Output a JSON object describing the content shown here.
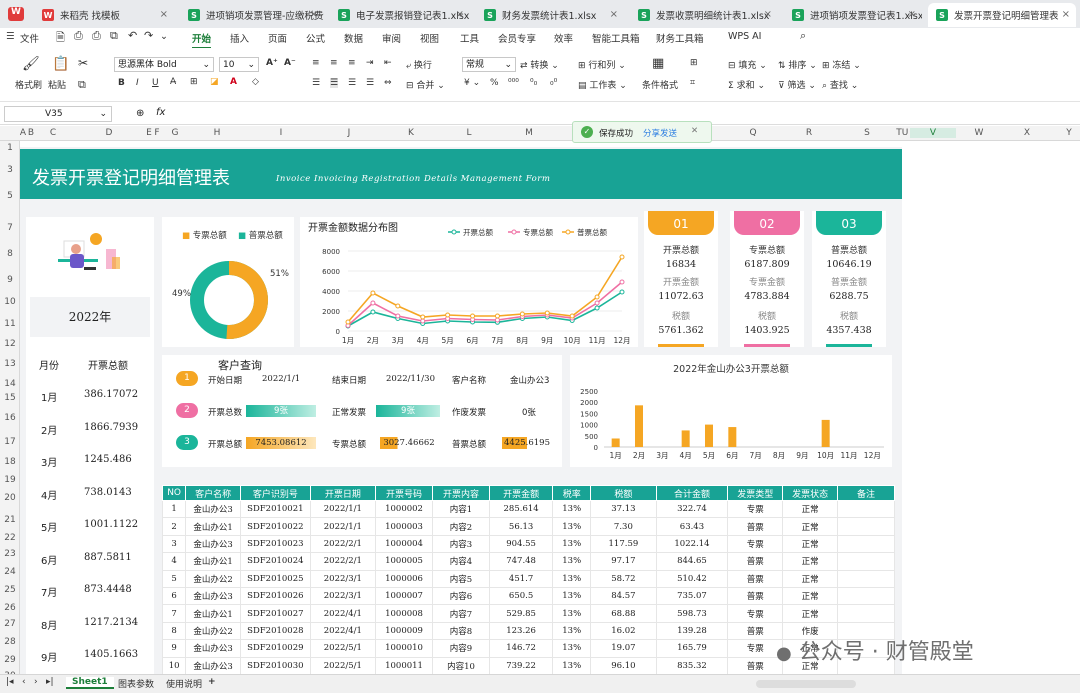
{
  "tabs": [
    {
      "label": "来稻壳 找模板",
      "color": "#e03b3b"
    },
    {
      "label": "进项销项发票管理-应缴税费计算",
      "color": "#1aa35a"
    },
    {
      "label": "电子发票报销登记表1.xlsx",
      "color": "#1aa35a"
    },
    {
      "label": "财务发票统计表1.xlsx",
      "color": "#1aa35a"
    },
    {
      "label": "发票收票明细统计表1.xlsx",
      "color": "#1aa35a"
    },
    {
      "label": "进项销项发票登记表1.xlsx",
      "color": "#1aa35a"
    },
    {
      "label": "发票开票登记明细管理表",
      "color": "#1aa35a"
    }
  ],
  "menu": {
    "file": "文件",
    "items": [
      "开始",
      "插入",
      "页面",
      "公式",
      "数据",
      "审阅",
      "视图",
      "工具",
      "会员专享",
      "效率",
      "智能工具箱",
      "财务工具箱",
      "WPS AI"
    ]
  },
  "ribbon": {
    "format_painter": "格式刷",
    "paste": "粘贴",
    "font": "思源黑体 Bold",
    "size": "10",
    "wrap": "换行",
    "merge": "合并",
    "numfmt": "常规",
    "convert": "转换",
    "rowcol": "行和列",
    "worksheet": "工作表",
    "condfmt": "条件格式",
    "fill": "填充",
    "sort": "排序",
    "freeze": "冻结",
    "sum": "求和",
    "filter": "筛选",
    "find": "查找"
  },
  "formula": {
    "cellref": "V35",
    "fx": "fx"
  },
  "toast": {
    "text": "保存成功",
    "share": "分享发送"
  },
  "columns": [
    "A",
    "B",
    "C",
    "D",
    "E",
    "F",
    "G",
    "H",
    "I",
    "J",
    "K",
    "L",
    "M",
    "N",
    "O",
    "P",
    "Q",
    "R",
    "S",
    "T",
    "U",
    "V",
    "W",
    "X",
    "Y"
  ],
  "rows": [
    "1",
    "3",
    "5",
    "7",
    "8",
    "9",
    "10",
    "11",
    "12",
    "13",
    "14",
    "15",
    "16",
    "17",
    "18",
    "19",
    "20",
    "21",
    "22",
    "23",
    "24",
    "25",
    "26",
    "27",
    "28",
    "29",
    "30",
    "31"
  ],
  "banner": {
    "title": "发票开票登记明细管理表",
    "subtitle": "Invoice Invoicing Registration Details Management Form"
  },
  "left_panel": {
    "year": "2022年",
    "col_month": "月份",
    "col_total": "开票总额",
    "months": [
      {
        "m": "1月",
        "v": "386.17072"
      },
      {
        "m": "2月",
        "v": "1866.7939"
      },
      {
        "m": "3月",
        "v": "1245.486"
      },
      {
        "m": "4月",
        "v": "738.0143"
      },
      {
        "m": "5月",
        "v": "1001.1122"
      },
      {
        "m": "6月",
        "v": "887.5811"
      },
      {
        "m": "7月",
        "v": "873.4448"
      },
      {
        "m": "8月",
        "v": "1217.2134"
      },
      {
        "m": "9月",
        "v": "1405.1663"
      }
    ]
  },
  "donut": {
    "legend1": "专票总额",
    "legend2": "普票总额",
    "pct1": "51%",
    "pct2": "49%",
    "value1": 51,
    "value2": 49,
    "color1": "#f5a623",
    "color2": "#1bb59a"
  },
  "stats": [
    {
      "num": "01",
      "color": "#f5a623",
      "l1": "开票总额",
      "v1": "16834",
      "l2": "开票金额",
      "v2": "11072.63",
      "l3": "税额",
      "v3": "5761.362"
    },
    {
      "num": "02",
      "color": "#ef6fa3",
      "l1": "专票总额",
      "v1": "6187.809",
      "l2": "专票金额",
      "v2": "4783.884",
      "l3": "税额",
      "v3": "1403.925"
    },
    {
      "num": "03",
      "color": "#1bb59a",
      "l1": "普票总额",
      "v1": "10646.19",
      "l2": "普票金额",
      "v2": "6288.75",
      "l3": "税额",
      "v3": "4357.438"
    }
  ],
  "query": {
    "title": "客户查询",
    "start_label": "开始日期",
    "start": "2022/1/1",
    "end_label": "结束日期",
    "end": "2022/11/30",
    "cust_label": "客户名称",
    "cust": "金山办公3",
    "cnt_label": "开票总数",
    "cnt": "9张",
    "normal_label": "正常发票",
    "normal": "9张",
    "void_label": "作废发票",
    "void": "0张",
    "amt_label": "开票总额",
    "amt": "7453.08612",
    "sp_label": "专票总额",
    "sp": "3027.46662",
    "pp_label": "普票总额",
    "pp": "4425.6195"
  },
  "chart_data": [
    {
      "type": "line",
      "title": "开票金额数据分布图",
      "categories": [
        "1月",
        "2月",
        "3月",
        "4月",
        "5月",
        "6月",
        "7月",
        "8月",
        "9月",
        "10月",
        "11月",
        "12月"
      ],
      "ylim": [
        0,
        8000
      ],
      "yticks": [
        0,
        2000,
        4000,
        6000,
        8000
      ],
      "series": [
        {
          "name": "开票总额",
          "color": "#1bb59a",
          "values": [
            500,
            1900,
            1250,
            750,
            1000,
            900,
            870,
            1250,
            1400,
            1050,
            2300,
            3900
          ]
        },
        {
          "name": "专票总额",
          "color": "#ef6fa3",
          "values": [
            550,
            2800,
            1500,
            1000,
            1250,
            1150,
            1100,
            1450,
            1600,
            1300,
            2800,
            4900
          ]
        },
        {
          "name": "普票总额",
          "color": "#f5a623",
          "values": [
            900,
            3800,
            2500,
            1400,
            1600,
            1500,
            1500,
            1700,
            1800,
            1500,
            3400,
            7400
          ]
        }
      ]
    },
    {
      "type": "bar",
      "title": "2022年金山办公3开票总额",
      "categories": [
        "1月",
        "2月",
        "3月",
        "4月",
        "5月",
        "6月",
        "7月",
        "8月",
        "9月",
        "10月",
        "11月",
        "12月"
      ],
      "ylim": [
        0,
        2500
      ],
      "yticks": [
        0,
        500,
        1000,
        1500,
        2000,
        2500
      ],
      "color": "#f5a623",
      "values": [
        380,
        1860,
        0,
        740,
        1000,
        890,
        0,
        0,
        0,
        1210,
        0,
        0
      ]
    }
  ],
  "table": {
    "headers": [
      "NO",
      "客户名称",
      "客户识别号",
      "开票日期",
      "开票号码",
      "开票内容",
      "开票金额",
      "税率",
      "税额",
      "合计金额",
      "发票类型",
      "发票状态",
      "备注"
    ],
    "rows": [
      [
        "1",
        "金山办公3",
        "SDF2010021",
        "2022/1/1",
        "1000002",
        "内容1",
        "285.614",
        "13%",
        "37.13",
        "322.74",
        "专票",
        "正常",
        ""
      ],
      [
        "2",
        "金山办公1",
        "SDF2010022",
        "2022/1/1",
        "1000003",
        "内容2",
        "56.13",
        "13%",
        "7.30",
        "63.43",
        "普票",
        "正常",
        ""
      ],
      [
        "3",
        "金山办公3",
        "SDF2010023",
        "2022/2/1",
        "1000004",
        "内容3",
        "904.55",
        "13%",
        "117.59",
        "1022.14",
        "专票",
        "正常",
        ""
      ],
      [
        "4",
        "金山办公1",
        "SDF2010024",
        "2022/2/1",
        "1000005",
        "内容4",
        "747.48",
        "13%",
        "97.17",
        "844.65",
        "普票",
        "正常",
        ""
      ],
      [
        "5",
        "金山办公2",
        "SDF2010025",
        "2022/3/1",
        "1000006",
        "内容5",
        "451.7",
        "13%",
        "58.72",
        "510.42",
        "普票",
        "正常",
        ""
      ],
      [
        "6",
        "金山办公3",
        "SDF2010026",
        "2022/3/1",
        "1000007",
        "内容6",
        "650.5",
        "13%",
        "84.57",
        "735.07",
        "普票",
        "正常",
        ""
      ],
      [
        "7",
        "金山办公1",
        "SDF2010027",
        "2022/4/1",
        "1000008",
        "内容7",
        "529.85",
        "13%",
        "68.88",
        "598.73",
        "专票",
        "正常",
        ""
      ],
      [
        "8",
        "金山办公2",
        "SDF2010028",
        "2022/4/1",
        "1000009",
        "内容8",
        "123.26",
        "13%",
        "16.02",
        "139.28",
        "普票",
        "作废",
        ""
      ],
      [
        "9",
        "金山办公3",
        "SDF2010029",
        "2022/5/1",
        "1000010",
        "内容9",
        "146.72",
        "13%",
        "19.07",
        "165.79",
        "专票",
        "正常",
        ""
      ],
      [
        "10",
        "金山办公3",
        "SDF2010030",
        "2022/5/1",
        "1000011",
        "内容10",
        "739.22",
        "13%",
        "96.10",
        "835.32",
        "普票",
        "正常",
        ""
      ]
    ]
  },
  "sheets": [
    "Sheet1",
    "图表参数",
    "使用说明"
  ],
  "watermark": "公众号 · 财管殿堂",
  "colors": {
    "teal": "#18a395",
    "orange": "#f5a623",
    "pink": "#ef6fa3",
    "green": "#1bb59a"
  }
}
